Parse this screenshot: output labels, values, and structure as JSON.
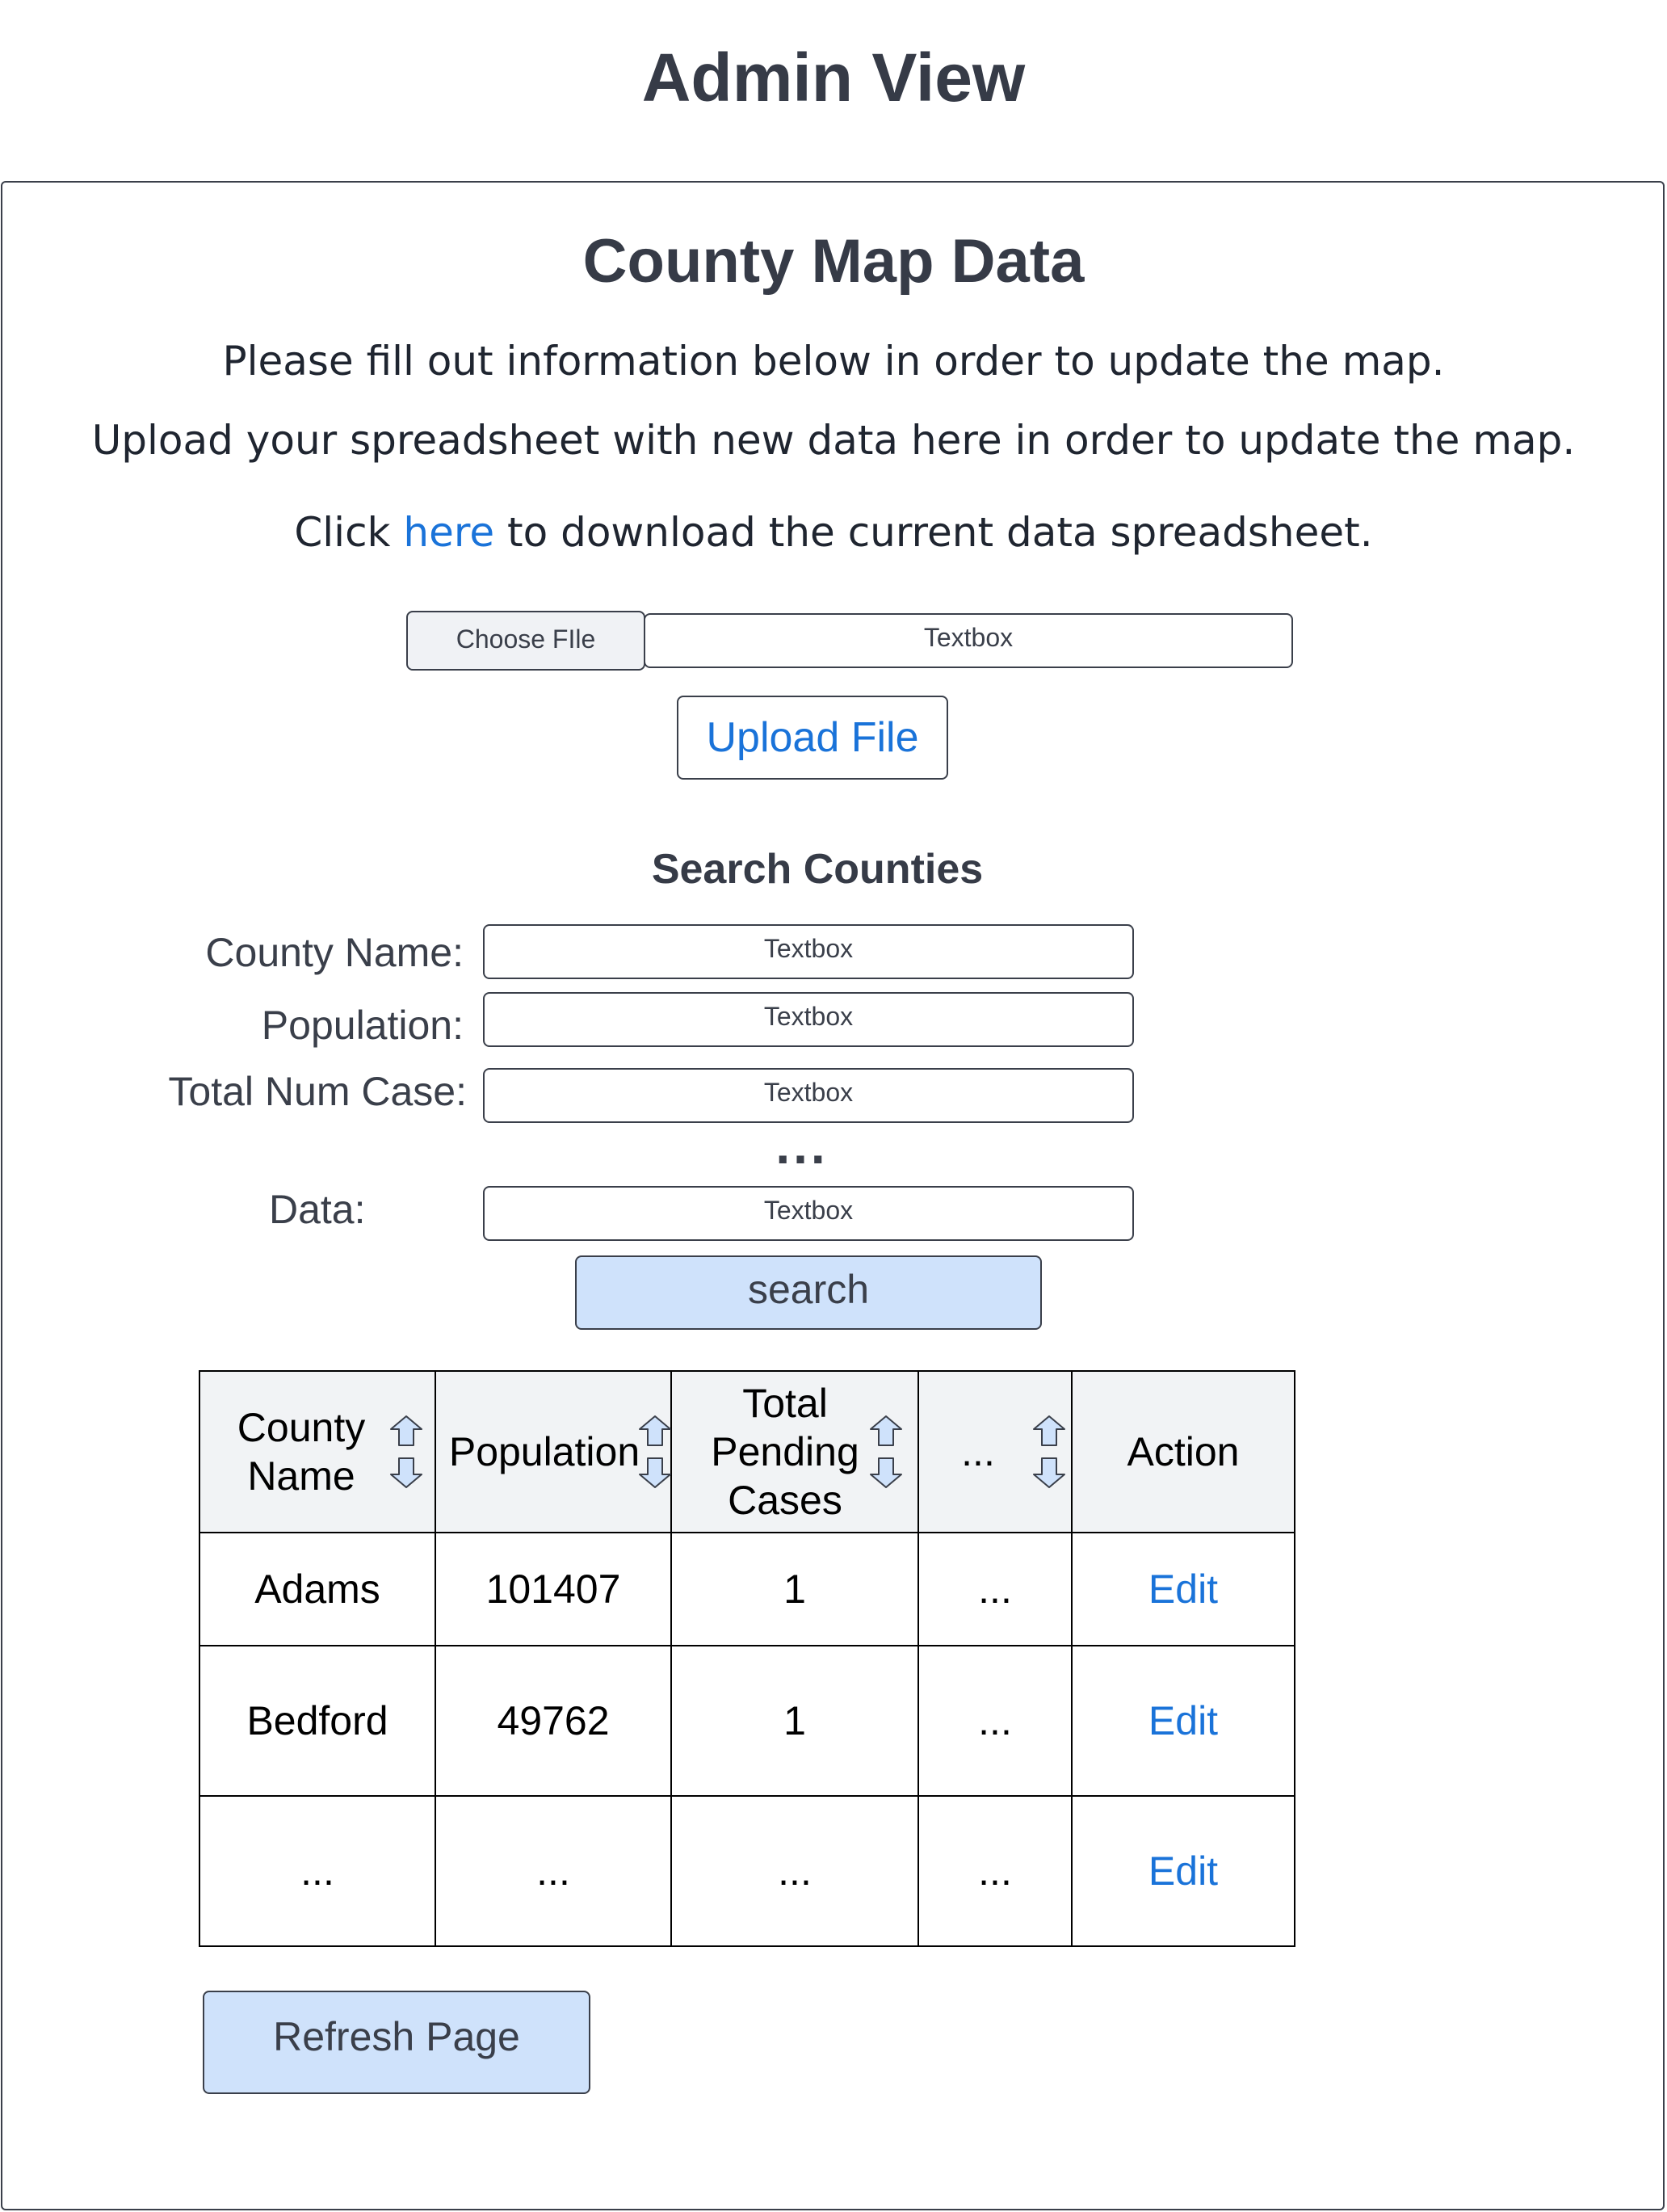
{
  "page": {
    "title": "Admin View"
  },
  "panel": {
    "title": "County Map Data",
    "instruction_1": "Please fill out information below in order to update the map.",
    "instruction_2": "Upload your spreadsheet with new data here in order to update the map.",
    "download": {
      "prefix": "Click ",
      "link_text": "here",
      "suffix": " to download the current data spreadsheet."
    }
  },
  "upload": {
    "choose_file_label": "Choose FIle",
    "file_textbox_value": "Textbox",
    "upload_button_label": "Upload File"
  },
  "search": {
    "title": "Search Counties",
    "fields": [
      {
        "label": "County Name:",
        "value": "Textbox"
      },
      {
        "label": "Population:",
        "value": "Textbox"
      },
      {
        "label": "Total Num Case:",
        "value": "Textbox"
      },
      {
        "label": "Data:",
        "value": "Textbox"
      }
    ],
    "more_fields_indicator": "...",
    "button_label": "search"
  },
  "table": {
    "headers": [
      "County Name",
      "Population",
      "Total Pending Cases",
      "...",
      "Action"
    ],
    "rows": [
      [
        "Adams",
        "101407",
        "1",
        "...",
        "Edit"
      ],
      [
        "Bedford",
        "49762",
        "1",
        "...",
        "Edit"
      ],
      [
        "...",
        "...",
        "...",
        "...",
        "Edit"
      ]
    ]
  },
  "refresh_button_label": "Refresh Page",
  "colors": {
    "link": "#1a73d9",
    "button_fill": "#cfe2fb",
    "header_fill": "#f1f3f5",
    "sort_icon_fill": "#cfe2fb"
  },
  "icons": {
    "sort": "sort-up-down-arrows-icon"
  }
}
